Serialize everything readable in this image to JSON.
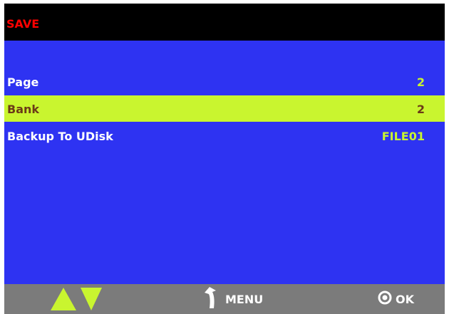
{
  "title": "SAVE",
  "rows": [
    {
      "label": "Page",
      "value": "2"
    },
    {
      "label": "Bank",
      "value": "2"
    },
    {
      "label": "Backup To UDisk",
      "value": "FILE01"
    }
  ],
  "selected_row": "Bank",
  "footer": {
    "menu_label": "MENU",
    "ok_label": "OK",
    "icons": [
      "up-arrow-icon",
      "down-arrow-icon",
      "return-arrow-icon",
      "ok-circle-icon"
    ]
  },
  "colors": {
    "screen_background": "#2e33f2",
    "title_bar": "#000000",
    "title_text": "#ff0000",
    "highlight": "#c9f52f",
    "highlight_text": "#6b3b17",
    "value_text": "#c9f52f",
    "footer_background": "#7b7b7b"
  }
}
